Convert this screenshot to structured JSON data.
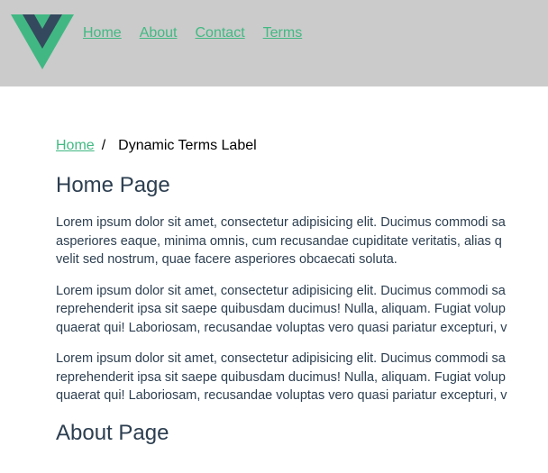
{
  "nav": {
    "items": [
      "Home",
      "About",
      "Contact",
      "Terms"
    ]
  },
  "breadcrumb": {
    "home": "Home",
    "separator": "/",
    "current": "Dynamic Terms Label"
  },
  "sections": {
    "home_title": "Home Page",
    "paragraphs": [
      {
        "lines": [
          "Lorem ipsum dolor sit amet, consectetur adipisicing elit. Ducimus commodi sa",
          "asperiores eaque, minima omnis, cum recusandae cupiditate veritatis, alias q",
          "velit sed nostrum, quae facere asperiores obcaecati soluta."
        ]
      },
      {
        "lines": [
          "Lorem ipsum dolor sit amet, consectetur adipisicing elit. Ducimus commodi sa",
          "reprehenderit ipsa sit saepe quibusdam ducimus! Nulla, aliquam. Fugiat volup",
          "quaerat qui! Laboriosam, recusandae voluptas vero quasi pariatur excepturi, v"
        ]
      },
      {
        "lines": [
          "Lorem ipsum dolor sit amet, consectetur adipisicing elit. Ducimus commodi sa",
          "reprehenderit ipsa sit saepe quibusdam ducimus! Nulla, aliquam. Fugiat volup",
          "quaerat qui! Laboriosam, recusandae voluptas vero quasi pariatur excepturi, v"
        ]
      }
    ],
    "about_title": "About Page"
  },
  "colors": {
    "header_bg": "#cbcbcb",
    "link": "#42b983",
    "text": "#2c3e50",
    "logo_outer": "#41b883",
    "logo_inner": "#34495e"
  },
  "icons": {
    "logo": "vue-logo-icon"
  }
}
